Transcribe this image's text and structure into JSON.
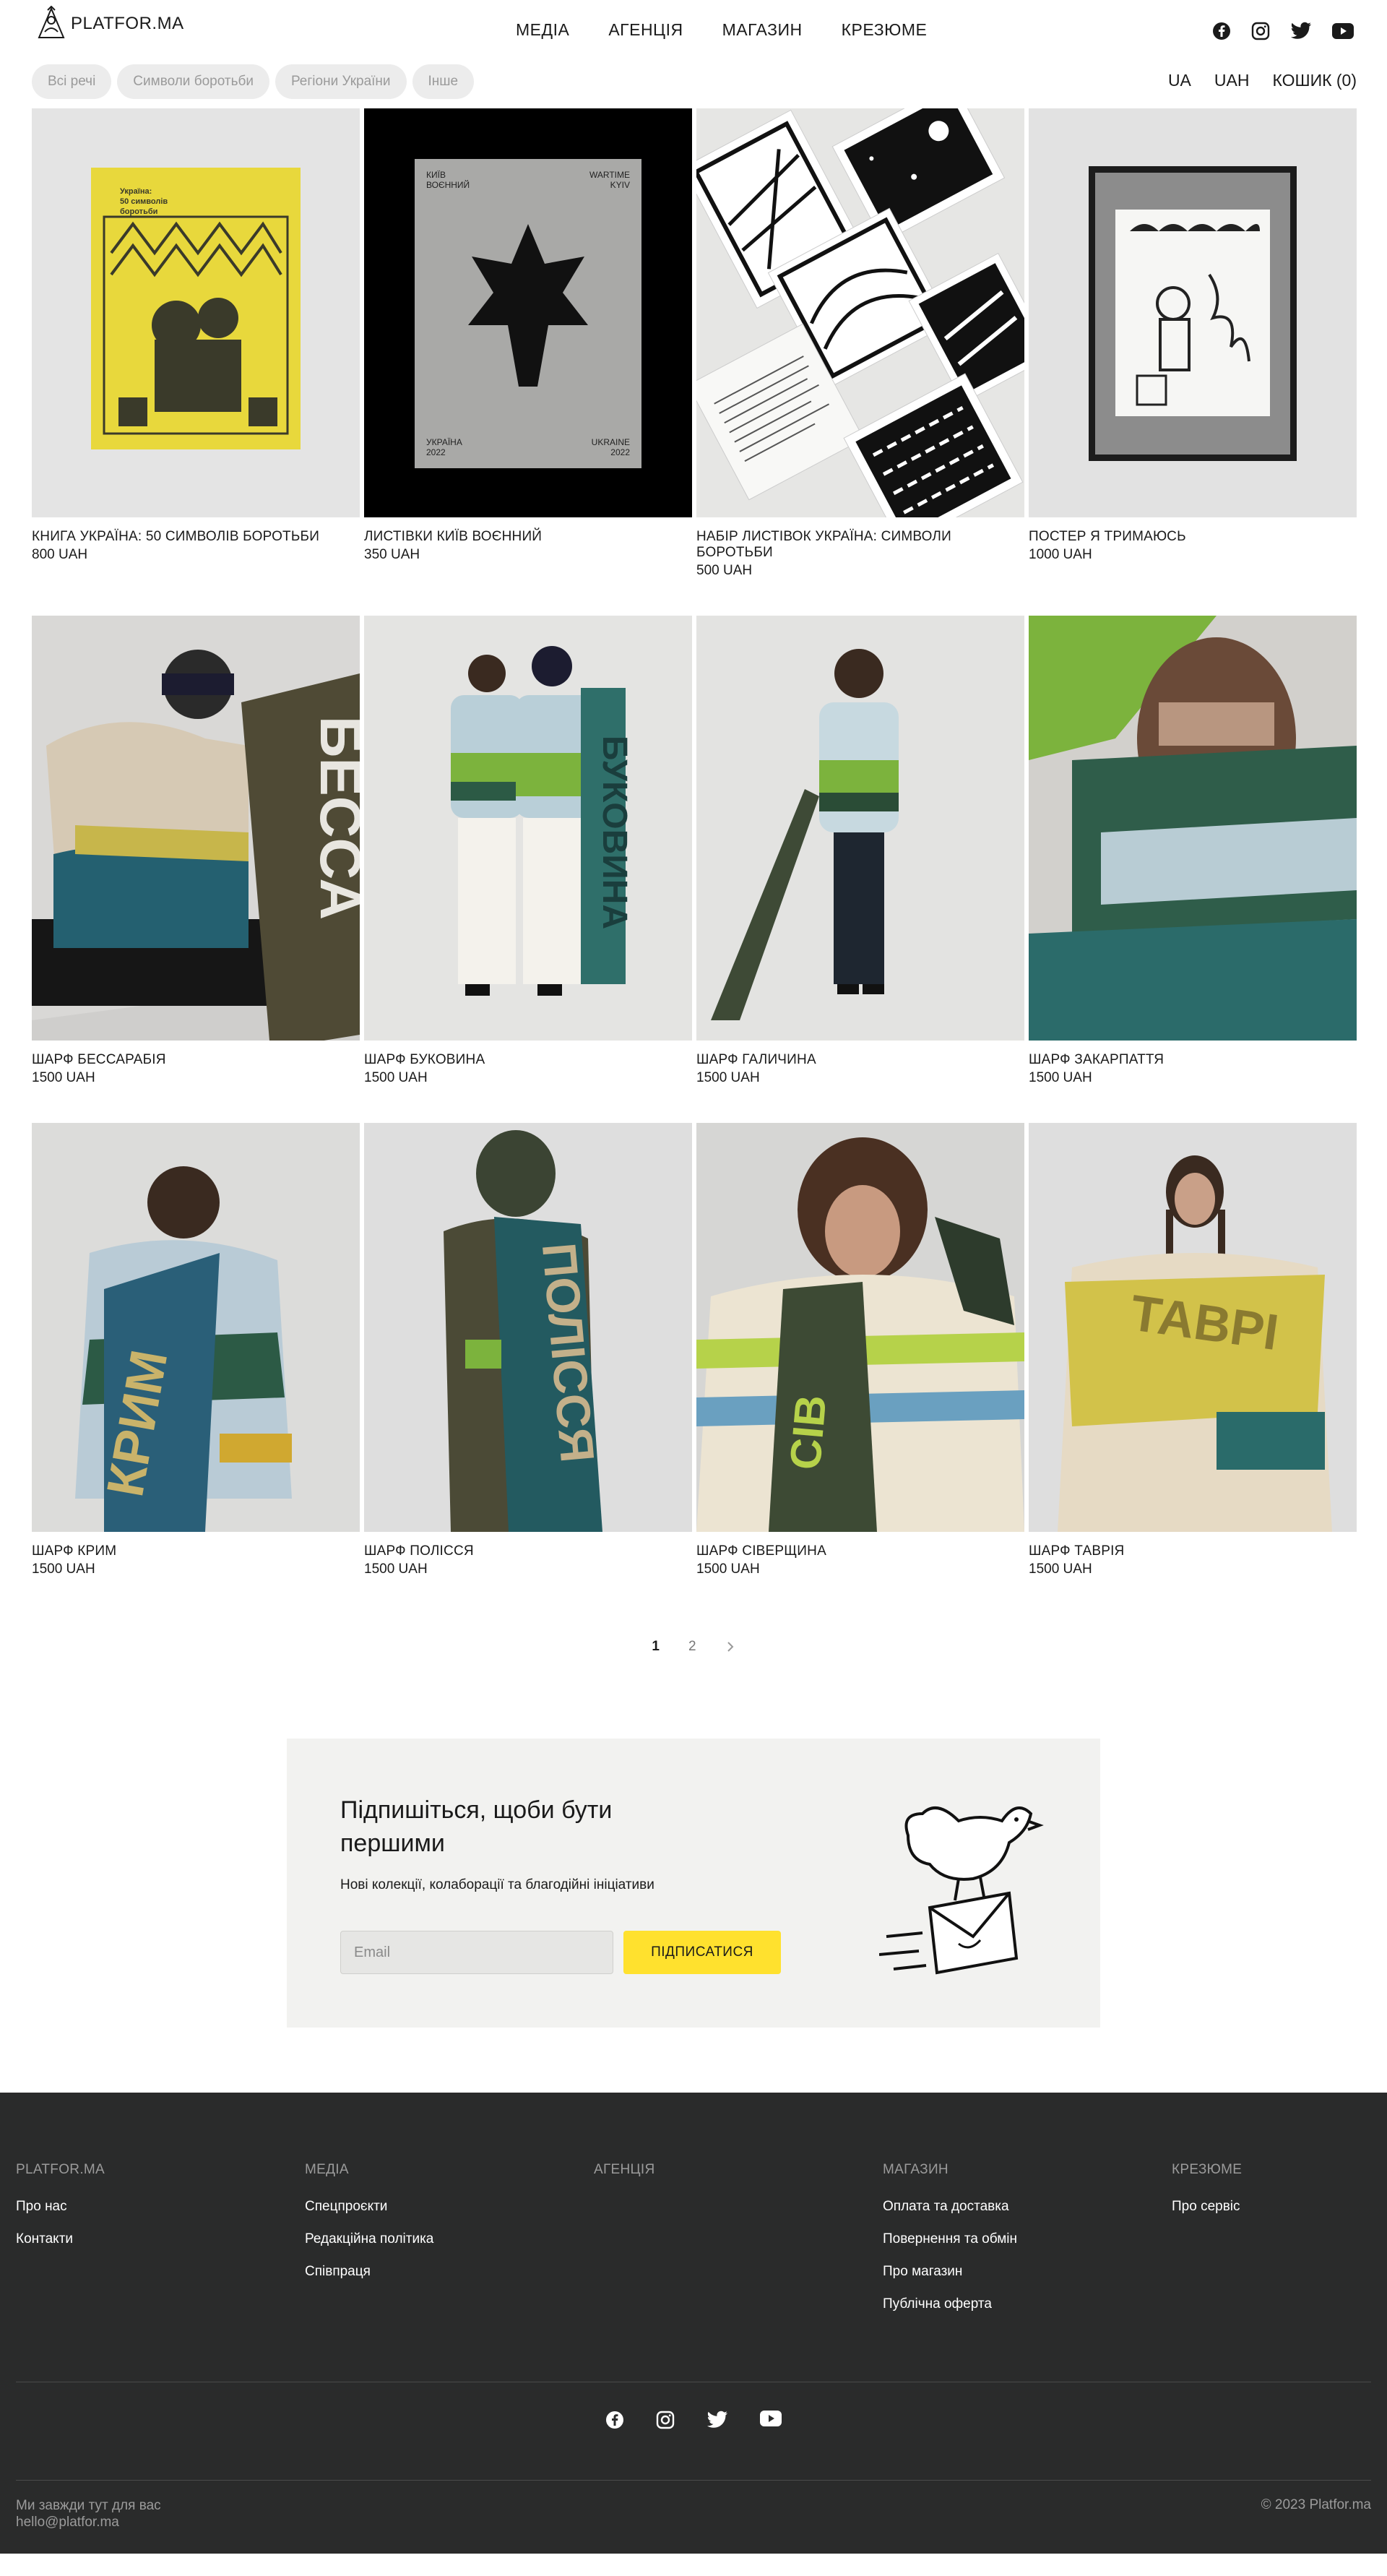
{
  "header": {
    "logo_text": "PLATFOR.MA",
    "nav": [
      "МЕДІА",
      "АГЕНЦІЯ",
      "МАГАЗИН",
      "КРЕЗЮМЕ"
    ],
    "social_icons": [
      "facebook-icon",
      "instagram-icon",
      "twitter-icon",
      "youtube-icon"
    ]
  },
  "filters": {
    "chips": [
      "Всі речі",
      "Символи боротьби",
      "Регіони України",
      "Інше"
    ],
    "lang": "UA",
    "currency": "UAH",
    "cart": "КОШИК (0)"
  },
  "products": [
    {
      "title": "КНИГА УКРАЇНА: 50 СИМВОЛІВ БОРОТЬБИ",
      "price": "800 UAH",
      "book_text": "Україна:\n50 символів\nборотьби"
    },
    {
      "title": "ЛИСТІВКИ КИЇВ ВОЄННИЙ",
      "price": "350 UAH",
      "cover_tl": "КИЇВ\nВОЄННИЙ",
      "cover_tr": "WARTIME\nKYIV",
      "cover_bl": "УКРАЇНА\n2022",
      "cover_br": "UKRAINE\n2022"
    },
    {
      "title": "НАБІР ЛИСТІВОК УКРАЇНА: СИМВОЛИ БОРОТЬБИ",
      "price": "500 UAH"
    },
    {
      "title": "ПОСТЕР Я ТРИМАЮСЬ",
      "price": "1000 UAH"
    },
    {
      "title": "ШАРФ БЕССАРАБІЯ",
      "price": "1500 UAH",
      "scarf_word": "БЕССА"
    },
    {
      "title": "ШАРФ БУКОВИНА",
      "price": "1500 UAH",
      "scarf_word": "БУКОВИНА"
    },
    {
      "title": "ШАРФ ГАЛИЧИНА",
      "price": "1500 UAH"
    },
    {
      "title": "ШАРФ ЗАКАРПАТТЯ",
      "price": "1500 UAH"
    },
    {
      "title": "ШАРФ КРИМ",
      "price": "1500 UAH",
      "scarf_word": "КРИМ"
    },
    {
      "title": "ШАРФ ПОЛІССЯ",
      "price": "1500 UAH",
      "scarf_word": "ПОЛІССЯ"
    },
    {
      "title": "ШАРФ СІВЕРЩИНА",
      "price": "1500 UAH",
      "scarf_word": "СІВ"
    },
    {
      "title": "ШАРФ ТАВРІЯ",
      "price": "1500 UAH",
      "scarf_word": "ТАВРІ"
    }
  ],
  "pagination": {
    "current": "1",
    "next_page": "2",
    "next_icon": "chevron-right-icon"
  },
  "subscribe": {
    "title": "Підпишіться, щоби бути першими",
    "text": "Нові колекції, колаборації та благодійні ініціативи",
    "placeholder": "Email",
    "button": "ПІДПИСАТИСЯ"
  },
  "footer": {
    "columns": [
      {
        "head": "PLATFOR.MA",
        "links": [
          "Про нас",
          "Контакти"
        ]
      },
      {
        "head": "МЕДІА",
        "links": [
          "Спецпроєкти",
          "Редакційна політика",
          "Співпраця"
        ]
      },
      {
        "head": "АГЕНЦІЯ",
        "links": []
      },
      {
        "head": "МАГАЗИН",
        "links": [
          "Оплата та доставка",
          "Повернення та обмін",
          "Про магазин",
          "Публічна оферта"
        ]
      },
      {
        "head": "КРЕЗЮМЕ",
        "links": [
          "Про сервіс"
        ]
      }
    ],
    "tagline": "Ми завжди тут для вас",
    "email": "hello@platfor.ma",
    "copyright": "© 2023 Platfor.ma"
  },
  "colors": {
    "accent_yellow": "#ffe12e",
    "footer_bg": "#2a2b2b",
    "subscribe_bg": "#f2f2f0",
    "chip_bg": "#ececec"
  }
}
